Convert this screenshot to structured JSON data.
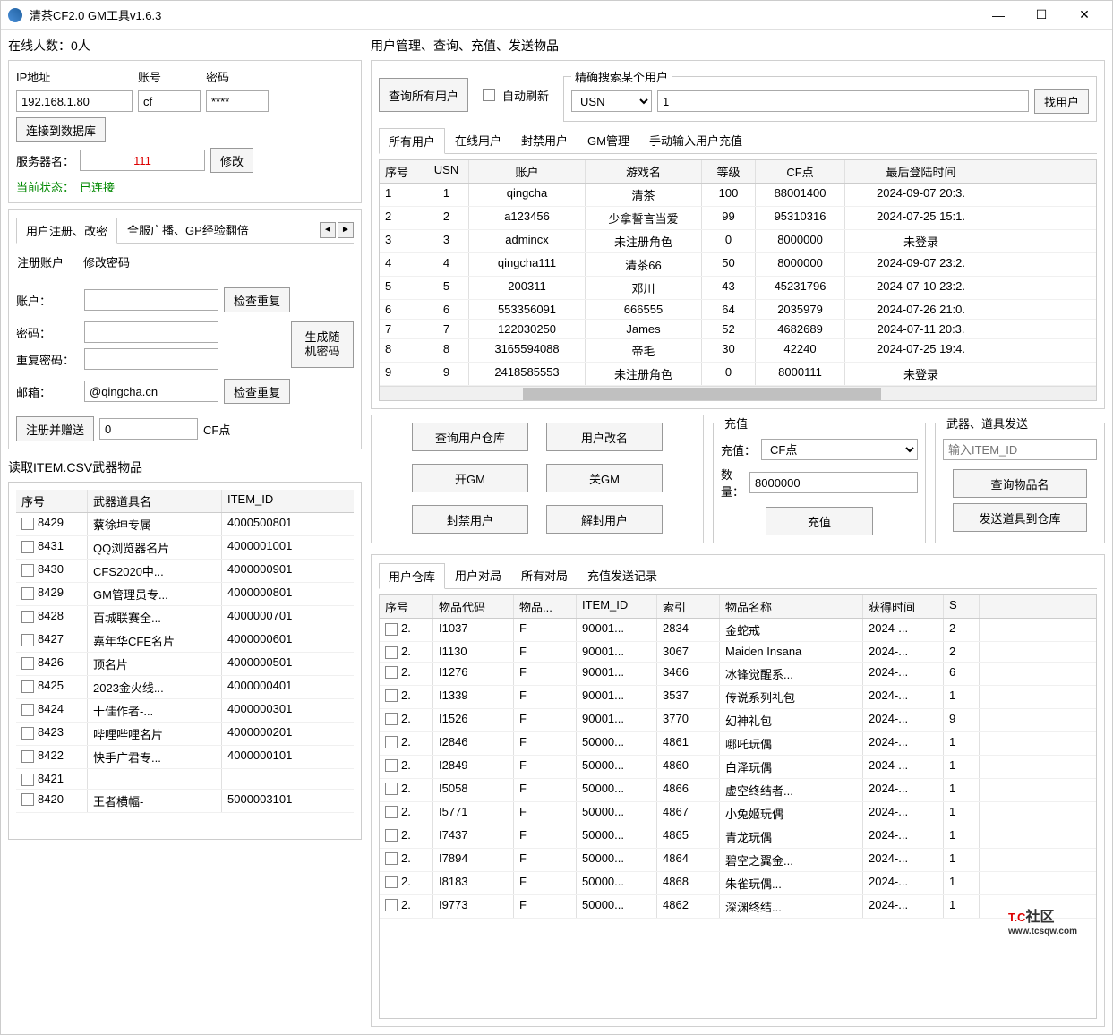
{
  "title": "清茶CF2.0 GM工具v1.6.3",
  "windowControls": {
    "min": "—",
    "max": "☐",
    "close": "✕"
  },
  "onlineCount": "在线人数：0人",
  "conn": {
    "ipLabel": "IP地址",
    "ip": "192.168.1.80",
    "acctLabel": "账号",
    "acct": "cf",
    "pwdLabel": "密码",
    "pwd": "****",
    "connectBtn": "连接到数据库",
    "serverLabel": "服务器名：",
    "serverVal": "111",
    "modifyBtn": "修改",
    "statusLabel": "当前状态：",
    "statusVal": "已连接"
  },
  "regTabs": {
    "t1": "用户注册、改密",
    "t2": "全服广播、GP经验翻倍"
  },
  "regSubTabs": {
    "t1": "注册账户",
    "t2": "修改密码"
  },
  "reg": {
    "acctLabel": "账户：",
    "checkDup": "检查重复",
    "pwdLabel": "密码：",
    "genPwd": "生成随机密码",
    "pwd2Label": "重复密码：",
    "emailLabel": "邮箱：",
    "emailVal": "@qingcha.cn",
    "regBtn": "注册并赠送",
    "cfAmount": "0",
    "cfLabel": "CF点"
  },
  "itemCsvTitle": "读取ITEM.CSV武器物品",
  "itemHeaders": [
    "序号",
    "武器道具名",
    "ITEM_ID"
  ],
  "items": [
    [
      "8429",
      "蔡徐坤专属",
      "4000500801"
    ],
    [
      "8431",
      "QQ浏览器名片",
      "4000001001"
    ],
    [
      "8430",
      "CFS2020中...",
      "4000000901"
    ],
    [
      "8429",
      "GM管理员专...",
      "4000000801"
    ],
    [
      "8428",
      "百城联赛全...",
      "4000000701"
    ],
    [
      "8427",
      "嘉年华CFE名片",
      "4000000601"
    ],
    [
      "8426",
      "顶名片",
      "4000000501"
    ],
    [
      "8425",
      "2023金火线...",
      "4000000401"
    ],
    [
      "8424",
      "十佳作者-...",
      "4000000301"
    ],
    [
      "8423",
      "哔哩哔哩名片",
      "4000000201"
    ],
    [
      "8422",
      "快手广君专...",
      "4000000101"
    ],
    [
      "8421",
      "",
      ""
    ],
    [
      "8420",
      "王者横幅-",
      "5000003101"
    ]
  ],
  "userMgmtTitle": "用户管理、查询、充值、发送物品",
  "queryAllBtn": "查询所有用户",
  "autoRefresh": "自动刷新",
  "searchGroup": "精确搜索某个用户",
  "searchType": "USN",
  "searchVal": "1",
  "findBtn": "找用户",
  "userTabs": [
    "所有用户",
    "在线用户",
    "封禁用户",
    "GM管理",
    "手动输入用户充值"
  ],
  "userHeaders": [
    "序号",
    "USN",
    "账户",
    "游戏名",
    "等级",
    "CF点",
    "最后登陆时间"
  ],
  "users": [
    [
      "1",
      "1",
      "qingcha",
      "清茶",
      "100",
      "88001400",
      "2024-09-07 20:3."
    ],
    [
      "2",
      "2",
      "a123456",
      "少拿誓言当爱",
      "99",
      "95310316",
      "2024-07-25 15:1."
    ],
    [
      "3",
      "3",
      "admincx",
      "未注册角色",
      "0",
      "8000000",
      "未登录"
    ],
    [
      "4",
      "4",
      "qingcha111",
      "清茶66",
      "50",
      "8000000",
      "2024-09-07 23:2."
    ],
    [
      "5",
      "5",
      "200311",
      "邓川",
      "43",
      "45231796",
      "2024-07-10 23:2."
    ],
    [
      "6",
      "6",
      "553356091",
      "666555",
      "64",
      "2035979",
      "2024-07-26 21:0."
    ],
    [
      "7",
      "7",
      "122030250",
      "James",
      "52",
      "4682689",
      "2024-07-11 20:3."
    ],
    [
      "8",
      "8",
      "3165594088",
      "帝毛",
      "30",
      "42240",
      "2024-07-25 19:4."
    ],
    [
      "9",
      "9",
      "2418585553",
      "未注册角色",
      "0",
      "8000111",
      "未登录"
    ]
  ],
  "actionBtns": {
    "queryWh": "查询用户仓库",
    "rename": "用户改名",
    "openGm": "开GM",
    "closeGm": "关GM",
    "ban": "封禁用户",
    "unban": "解封用户"
  },
  "recharge": {
    "title": "充值",
    "typeLabel": "充值：",
    "type": "CF点",
    "amtLabel": "数量：",
    "amt": "8000000",
    "btn": "充值"
  },
  "weapon": {
    "title": "武器、道具发送",
    "ph": "输入ITEM_ID",
    "queryBtn": "查询物品名",
    "sendBtn": "发送道具到仓库"
  },
  "whTabs": [
    "用户仓库",
    "用户对局",
    "所有对局",
    "充值发送记录"
  ],
  "whHeaders": [
    "序号",
    "物品代码",
    "物品...",
    "ITEM_ID",
    "索引",
    "物品名称",
    "获得时间",
    "S"
  ],
  "wh": [
    [
      "2.",
      "I1037",
      "F",
      "90001...",
      "2834",
      "金蛇戒",
      "2024-...",
      "2"
    ],
    [
      "2.",
      "I1130",
      "F",
      "90001...",
      "3067",
      "Maiden Insana",
      "2024-...",
      "2"
    ],
    [
      "2.",
      "I1276",
      "F",
      "90001...",
      "3466",
      "冰锋觉醒系...",
      "2024-...",
      "6"
    ],
    [
      "2.",
      "I1339",
      "F",
      "90001...",
      "3537",
      "传说系列礼包",
      "2024-...",
      "1"
    ],
    [
      "2.",
      "I1526",
      "F",
      "90001...",
      "3770",
      "幻神礼包",
      "2024-...",
      "9"
    ],
    [
      "2.",
      "I2846",
      "F",
      "50000...",
      "4861",
      "哪吒玩偶",
      "2024-...",
      "1"
    ],
    [
      "2.",
      "I2849",
      "F",
      "50000...",
      "4860",
      "白泽玩偶",
      "2024-...",
      "1"
    ],
    [
      "2.",
      "I5058",
      "F",
      "50000...",
      "4866",
      "虚空终结者...",
      "2024-...",
      "1"
    ],
    [
      "2.",
      "I5771",
      "F",
      "50000...",
      "4867",
      "小兔姬玩偶",
      "2024-...",
      "1"
    ],
    [
      "2.",
      "I7437",
      "F",
      "50000...",
      "4865",
      "青龙玩偶",
      "2024-...",
      "1"
    ],
    [
      "2.",
      "I7894",
      "F",
      "50000...",
      "4864",
      "碧空之翼金...",
      "2024-...",
      "1"
    ],
    [
      "2.",
      "I8183",
      "F",
      "50000...",
      "4868",
      "朱雀玩偶...",
      "2024-...",
      "1"
    ],
    [
      "2.",
      "I9773",
      "F",
      "50000...",
      "4862",
      "深渊终结...",
      "2024-...",
      "1"
    ]
  ],
  "watermark": {
    "main": "T.C",
    "sub": "www.tcsqw.com",
    "side": "社区"
  }
}
